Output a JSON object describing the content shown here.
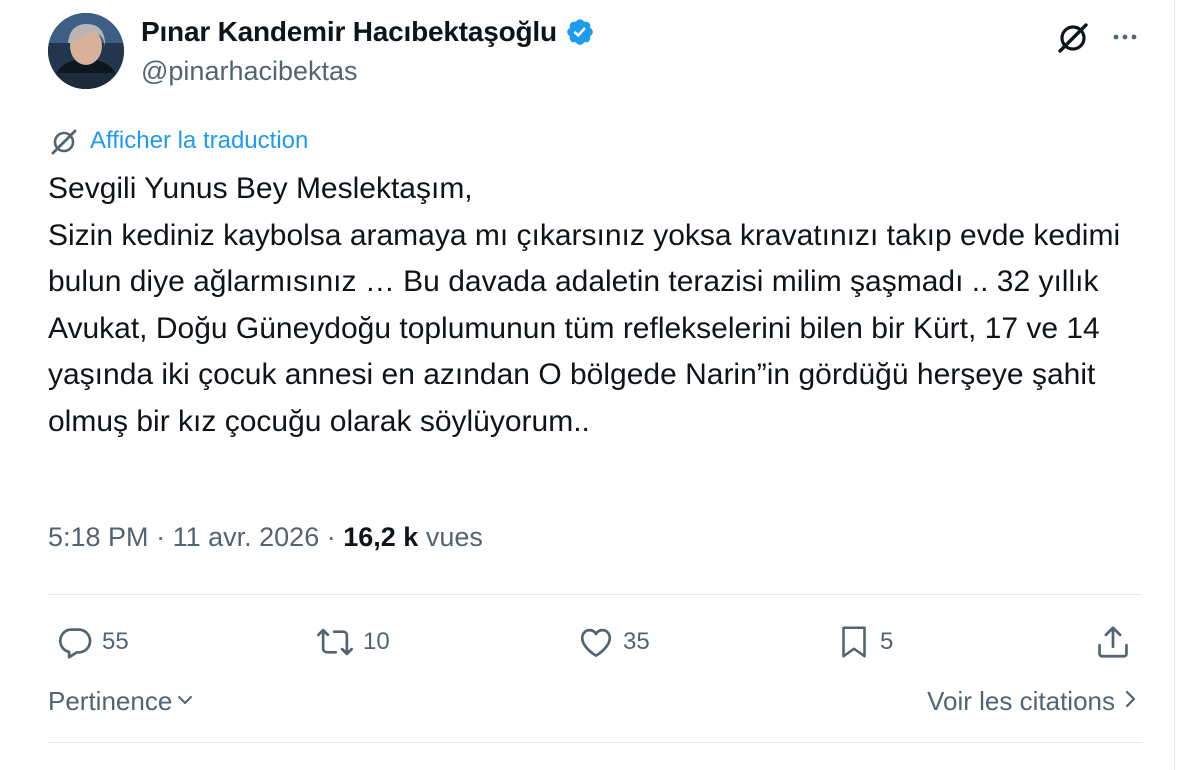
{
  "author": {
    "display_name": "Pınar Kandemir Hacıbektaşoğlu",
    "handle": "@pinarhacibektas",
    "verified": true
  },
  "translate_label": "Afficher la traduction",
  "tweet_text": "Sevgili Yunus Bey Meslektaşım,\nSizin kediniz kaybolsa aramaya mı çıkarsınız  yoksa kravatınızı takıp evde kedimi bulun diye ağlarmısınız … Bu davada adaletin terazisi milim şaşmadı .. 32 yıllık Avukat, Doğu Güneydoğu toplumunun tüm reflekselerini  bilen bir Kürt, 17 ve 14 yaşında iki çocuk annesi en azından O bölgede Narin”in gördüğü herşeye şahit olmuş bir kız çocuğu olarak söylüyorum..",
  "meta": {
    "time": "5:18 PM",
    "separator": "·",
    "date": "11 avr. 2026",
    "views_count": "16,2 k",
    "views_label": "vues"
  },
  "actions": {
    "replies": "55",
    "reposts": "10",
    "likes": "35",
    "bookmarks": "5"
  },
  "footer": {
    "sort_label": "Pertinence",
    "quotes_label": "Voir les citations"
  },
  "colors": {
    "accent": "#1d9bf0",
    "secondary_text": "#536471",
    "primary_text": "#0f1419",
    "divider": "#e6e9eb"
  },
  "icons": [
    "grok-icon",
    "more-icon",
    "translate-icon",
    "reply-icon",
    "repost-icon",
    "like-icon",
    "bookmark-icon",
    "share-icon",
    "chevron-down-icon",
    "chevron-right-icon",
    "verified-badge-icon"
  ]
}
